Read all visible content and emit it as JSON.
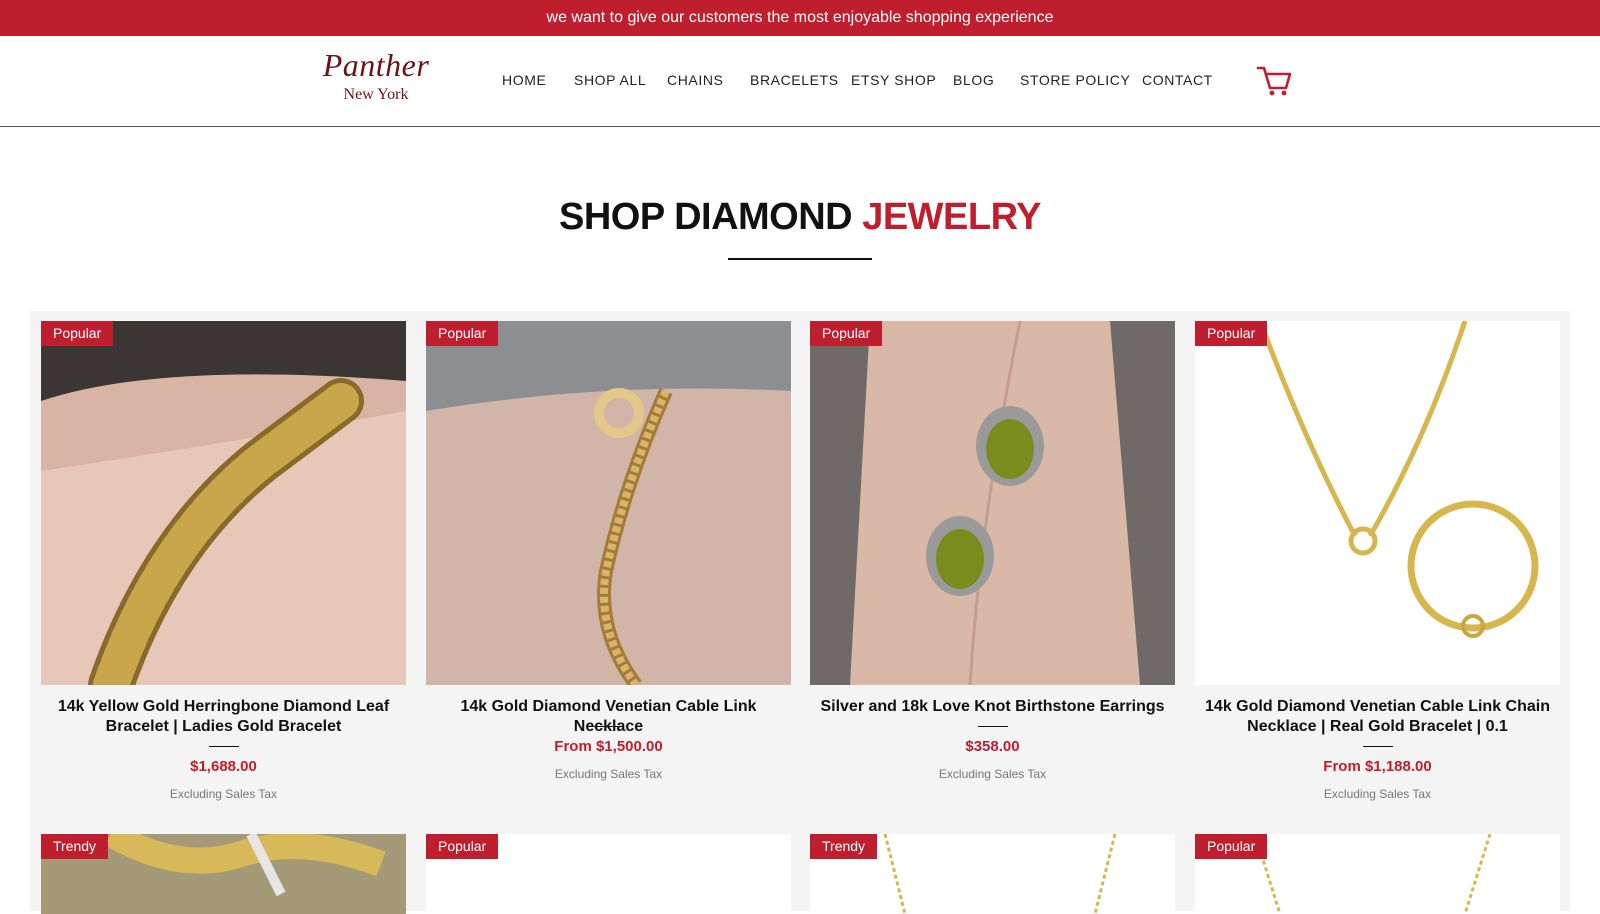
{
  "announcement": "we want to give our customers the most enjoyable shopping experience",
  "brand": {
    "name": "Panther",
    "sub": "New York"
  },
  "nav": [
    "HOME",
    "SHOP ALL",
    "CHAINS",
    "BRACELETS",
    "ETSY SHOP",
    "BLOG",
    "STORE POLICY",
    "CONTACT"
  ],
  "cart_icon": "cart-icon",
  "section": {
    "title_main": "SHOP DIAMOND",
    "title_accent": "JEWELRY"
  },
  "products": [
    {
      "badge": "Popular",
      "title": "14k Yellow Gold Herringbone Diamond Leaf Bracelet | Ladies Gold Bracelet",
      "price": "$1,688.00",
      "tax": "Excluding Sales Tax"
    },
    {
      "badge": "Popular",
      "title": "14k Gold Diamond Venetian Cable Link Necklace",
      "price": "From $1,500.00",
      "tax": "Excluding Sales Tax"
    },
    {
      "badge": "Popular",
      "title": "Silver and 18k Love Knot Birthstone Earrings",
      "price": "$358.00",
      "tax": "Excluding Sales Tax"
    },
    {
      "badge": "Popular",
      "title": "14k Gold Diamond Venetian Cable Link Chain Necklace | Real Gold Bracelet | 0.1",
      "price": "From $1,188.00",
      "tax": "Excluding Sales Tax"
    }
  ],
  "row2_badges": [
    "Trendy",
    "Popular",
    "Trendy",
    "Popular"
  ],
  "colors": {
    "brand_red": "#bf1e2e",
    "text_dark": "#111111"
  }
}
